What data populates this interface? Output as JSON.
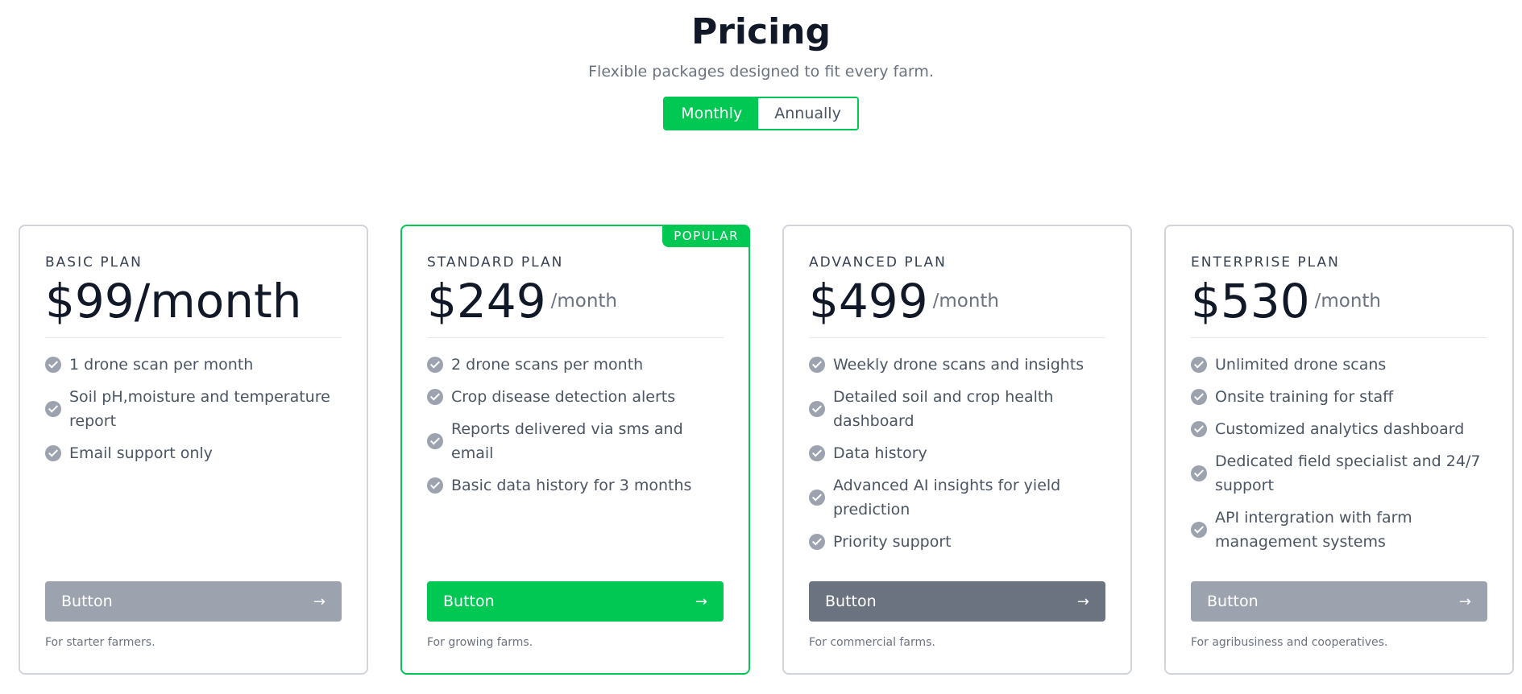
{
  "header": {
    "title": "Pricing",
    "subtitle": "Flexible packages designed to fit every farm."
  },
  "billing_toggle": {
    "options": [
      "Monthly",
      "Annually"
    ],
    "selected": "Monthly"
  },
  "colors": {
    "accent": "#00c853",
    "button_gray": "#9ca3af",
    "button_dark": "#6b7280"
  },
  "plans": [
    {
      "name": "BASIC PLAN",
      "price": "$99/month",
      "period": "",
      "popular": false,
      "features": [
        "1 drone scan per month",
        "Soil pH,moisture and temperature report",
        "Email support only"
      ],
      "button_label": "Button",
      "button_color": "#9ca3af",
      "note": "For starter farmers."
    },
    {
      "name": "STANDARD PLAN",
      "price": "$249",
      "period": "/month",
      "popular": true,
      "badge": "POPULAR",
      "features": [
        "2 drone scans per month",
        "Crop disease detection alerts",
        "Reports delivered via sms and email",
        "Basic data history for 3 months"
      ],
      "button_label": "Button",
      "button_color": "#00c853",
      "note": "For growing farms."
    },
    {
      "name": "ADVANCED PLAN",
      "price": "$499",
      "period": "/month",
      "popular": false,
      "features": [
        "Weekly drone scans and insights",
        "Detailed soil and crop health dashboard",
        "Data history",
        "Advanced AI insights for yield prediction",
        "Priority support"
      ],
      "button_label": "Button",
      "button_color": "#6b7280",
      "note": "For commercial farms."
    },
    {
      "name": "ENTERPRISE PLAN",
      "price": "$530",
      "period": "/month",
      "popular": false,
      "features": [
        "Unlimited drone scans",
        "Onsite training for staff",
        "Customized analytics dashboard",
        "Dedicated field specialist and 24/7 support",
        "API intergration with farm management systems"
      ],
      "button_label": "Button",
      "button_color": "#9ca3af",
      "note": "For agribusiness and cooperatives."
    }
  ]
}
